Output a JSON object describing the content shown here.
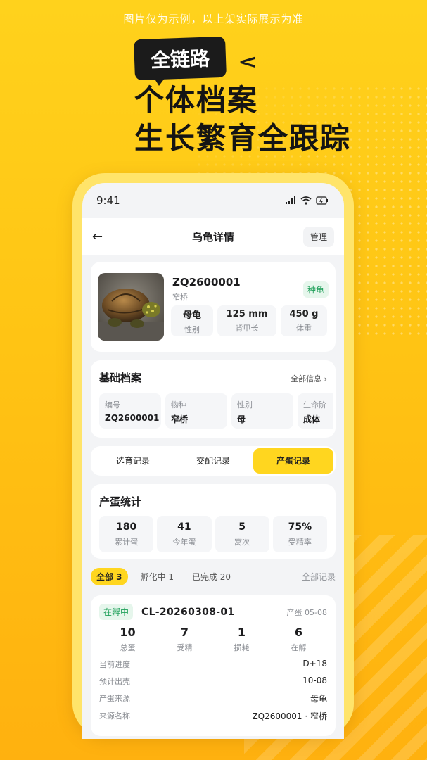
{
  "promo": {
    "disclaimer": "图片仅为示例，以上架实际展示为准",
    "bubble": "全链路",
    "headline1": "个体档案",
    "headline2": "生长繁育全跟踪"
  },
  "status_bar": {
    "time": "9:41"
  },
  "nav": {
    "title": "乌龟详情",
    "manage_label": "管理"
  },
  "turtle": {
    "id": "ZQ2600001",
    "species": "窄桥",
    "badge": "种龟",
    "stats": [
      {
        "value": "母龟",
        "label": "性别"
      },
      {
        "value": "125 mm",
        "label": "背甲长"
      },
      {
        "value": "450 g",
        "label": "体重"
      }
    ]
  },
  "archive": {
    "title": "基础档案",
    "all_info": "全部信息",
    "fields": [
      {
        "label": "编号",
        "value": "ZQ2600001"
      },
      {
        "label": "物种",
        "value": "窄桥"
      },
      {
        "label": "性别",
        "value": "母"
      },
      {
        "label": "生命阶",
        "value": "成体"
      }
    ]
  },
  "tabs": [
    "选育记录",
    "交配记录",
    "产蛋记录"
  ],
  "egg_stats": {
    "title": "产蛋统计",
    "items": [
      {
        "value": "180",
        "label": "累计蛋"
      },
      {
        "value": "41",
        "label": "今年蛋"
      },
      {
        "value": "5",
        "label": "窝次"
      },
      {
        "value": "75%",
        "label": "受精率"
      }
    ]
  },
  "filters": {
    "chips": [
      "全部 3",
      "孵化中 1",
      "已完成 20"
    ],
    "all_records": "全部记录"
  },
  "batch": {
    "status": "在孵中",
    "id": "CL-20260308-01",
    "date": "产蛋 05-08",
    "nums": [
      {
        "value": "10",
        "label": "总蛋"
      },
      {
        "value": "7",
        "label": "受精"
      },
      {
        "value": "1",
        "label": "损耗"
      },
      {
        "value": "6",
        "label": "在孵"
      }
    ],
    "details": [
      {
        "label": "当前进度",
        "value": "D+18"
      },
      {
        "label": "预计出壳",
        "value": "10-08"
      },
      {
        "label": "产蛋来源",
        "value": "母龟"
      },
      {
        "label": "来源名称",
        "value": "ZQ2600001 · 窄桥"
      }
    ]
  }
}
